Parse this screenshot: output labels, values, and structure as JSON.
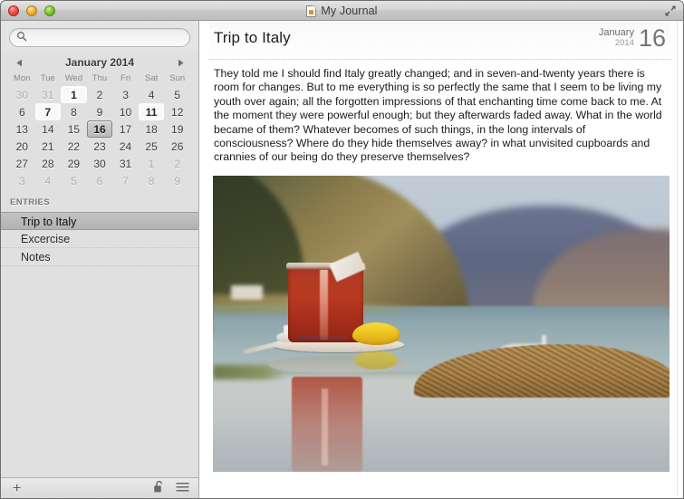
{
  "window": {
    "title": "My Journal",
    "doc_icon": "document-icon",
    "fullscreen_icon": "fullscreen-arrows-icon",
    "traffic_lights": [
      {
        "name": "close-button",
        "color": "#f0524a"
      },
      {
        "name": "minimize-button",
        "color": "#f2b43a"
      },
      {
        "name": "zoom-button",
        "color": "#86c63c"
      }
    ]
  },
  "sidebar": {
    "search": {
      "icon": "search-icon",
      "value": "",
      "placeholder": ""
    },
    "calendar": {
      "prev_icon": "triangle-left-icon",
      "next_icon": "triangle-right-icon",
      "month_label": "January 2014",
      "month": "January",
      "year": "2014",
      "weekdays": [
        "Mon",
        "Tue",
        "Wed",
        "Thu",
        "Fri",
        "Sat",
        "Sun"
      ],
      "weeks": [
        [
          {
            "d": "30",
            "state": "other"
          },
          {
            "d": "31",
            "state": "other"
          },
          {
            "d": "1",
            "state": "hasentry"
          },
          {
            "d": "2",
            "state": "normal"
          },
          {
            "d": "3",
            "state": "normal"
          },
          {
            "d": "4",
            "state": "normal"
          },
          {
            "d": "5",
            "state": "normal"
          }
        ],
        [
          {
            "d": "6",
            "state": "normal"
          },
          {
            "d": "7",
            "state": "hasentry"
          },
          {
            "d": "8",
            "state": "normal"
          },
          {
            "d": "9",
            "state": "normal"
          },
          {
            "d": "10",
            "state": "normal"
          },
          {
            "d": "11",
            "state": "hasentry"
          },
          {
            "d": "12",
            "state": "normal"
          }
        ],
        [
          {
            "d": "13",
            "state": "normal"
          },
          {
            "d": "14",
            "state": "normal"
          },
          {
            "d": "15",
            "state": "normal"
          },
          {
            "d": "16",
            "state": "selected"
          },
          {
            "d": "17",
            "state": "normal"
          },
          {
            "d": "18",
            "state": "normal"
          },
          {
            "d": "19",
            "state": "normal"
          }
        ],
        [
          {
            "d": "20",
            "state": "normal"
          },
          {
            "d": "21",
            "state": "normal"
          },
          {
            "d": "22",
            "state": "normal"
          },
          {
            "d": "23",
            "state": "normal"
          },
          {
            "d": "24",
            "state": "normal"
          },
          {
            "d": "25",
            "state": "normal"
          },
          {
            "d": "26",
            "state": "normal"
          }
        ],
        [
          {
            "d": "27",
            "state": "normal"
          },
          {
            "d": "28",
            "state": "normal"
          },
          {
            "d": "29",
            "state": "normal"
          },
          {
            "d": "30",
            "state": "normal"
          },
          {
            "d": "31",
            "state": "normal"
          },
          {
            "d": "1",
            "state": "other"
          },
          {
            "d": "2",
            "state": "other"
          }
        ],
        [
          {
            "d": "3",
            "state": "other"
          },
          {
            "d": "4",
            "state": "other"
          },
          {
            "d": "5",
            "state": "other"
          },
          {
            "d": "6",
            "state": "other"
          },
          {
            "d": "7",
            "state": "other"
          },
          {
            "d": "8",
            "state": "other"
          },
          {
            "d": "9",
            "state": "other"
          }
        ]
      ]
    },
    "entries_header": "ENTRIES",
    "entries": [
      {
        "title": "Trip to Italy",
        "selected": true
      },
      {
        "title": "Excercise",
        "selected": false
      },
      {
        "title": "Notes",
        "selected": false
      }
    ],
    "footer": {
      "add_label": "+",
      "lock_icon": "unlocked-padlock-icon",
      "menu_icon": "hamburger-menu-icon"
    }
  },
  "content": {
    "entry_title": "Trip to Italy",
    "date": {
      "month": "January",
      "year": "2014",
      "day": "16"
    },
    "body": "They told me I should find Italy greatly changed; and in seven-and-twenty years there is room for changes.  But to me everything is so perfectly the same that I seem to be living my youth over again; all the forgotten impressions of that enchanting time come back to me.  At the moment they were powerful enough; but they afterwards faded away.  What in the world became of them?  Whatever becomes of such things, in the long intervals of consciousness? Where do they hide themselves away? in what unvisited cupboards and crannies of our being do they preserve themselves?",
    "photo": {
      "name": "journal-photo",
      "description": "Glass of red tea with lemon slice on a saucer on a reflective table, sea and mountains blurred in background"
    }
  }
}
